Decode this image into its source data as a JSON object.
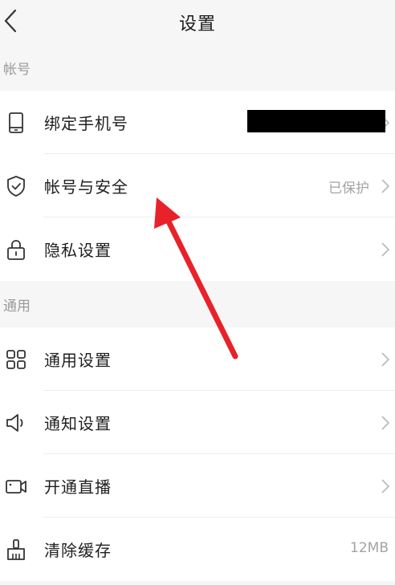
{
  "header": {
    "title": "设置"
  },
  "sections": [
    {
      "title": "帐号",
      "items": [
        {
          "label": "绑定手机号",
          "value": "",
          "icon": "phone-icon"
        },
        {
          "label": "帐号与安全",
          "value": "已保护",
          "icon": "shield-icon"
        },
        {
          "label": "隐私设置",
          "value": "",
          "icon": "lock-icon"
        }
      ]
    },
    {
      "title": "通用",
      "items": [
        {
          "label": "通用设置",
          "value": "",
          "icon": "grid-icon"
        },
        {
          "label": "通知设置",
          "value": "",
          "icon": "speaker-icon"
        },
        {
          "label": "开通直播",
          "value": "",
          "icon": "video-camera-icon"
        },
        {
          "label": "清除缓存",
          "value": "12MB",
          "icon": "broom-icon"
        }
      ]
    }
  ],
  "colors": {
    "annotation_arrow": "#e8222a"
  }
}
